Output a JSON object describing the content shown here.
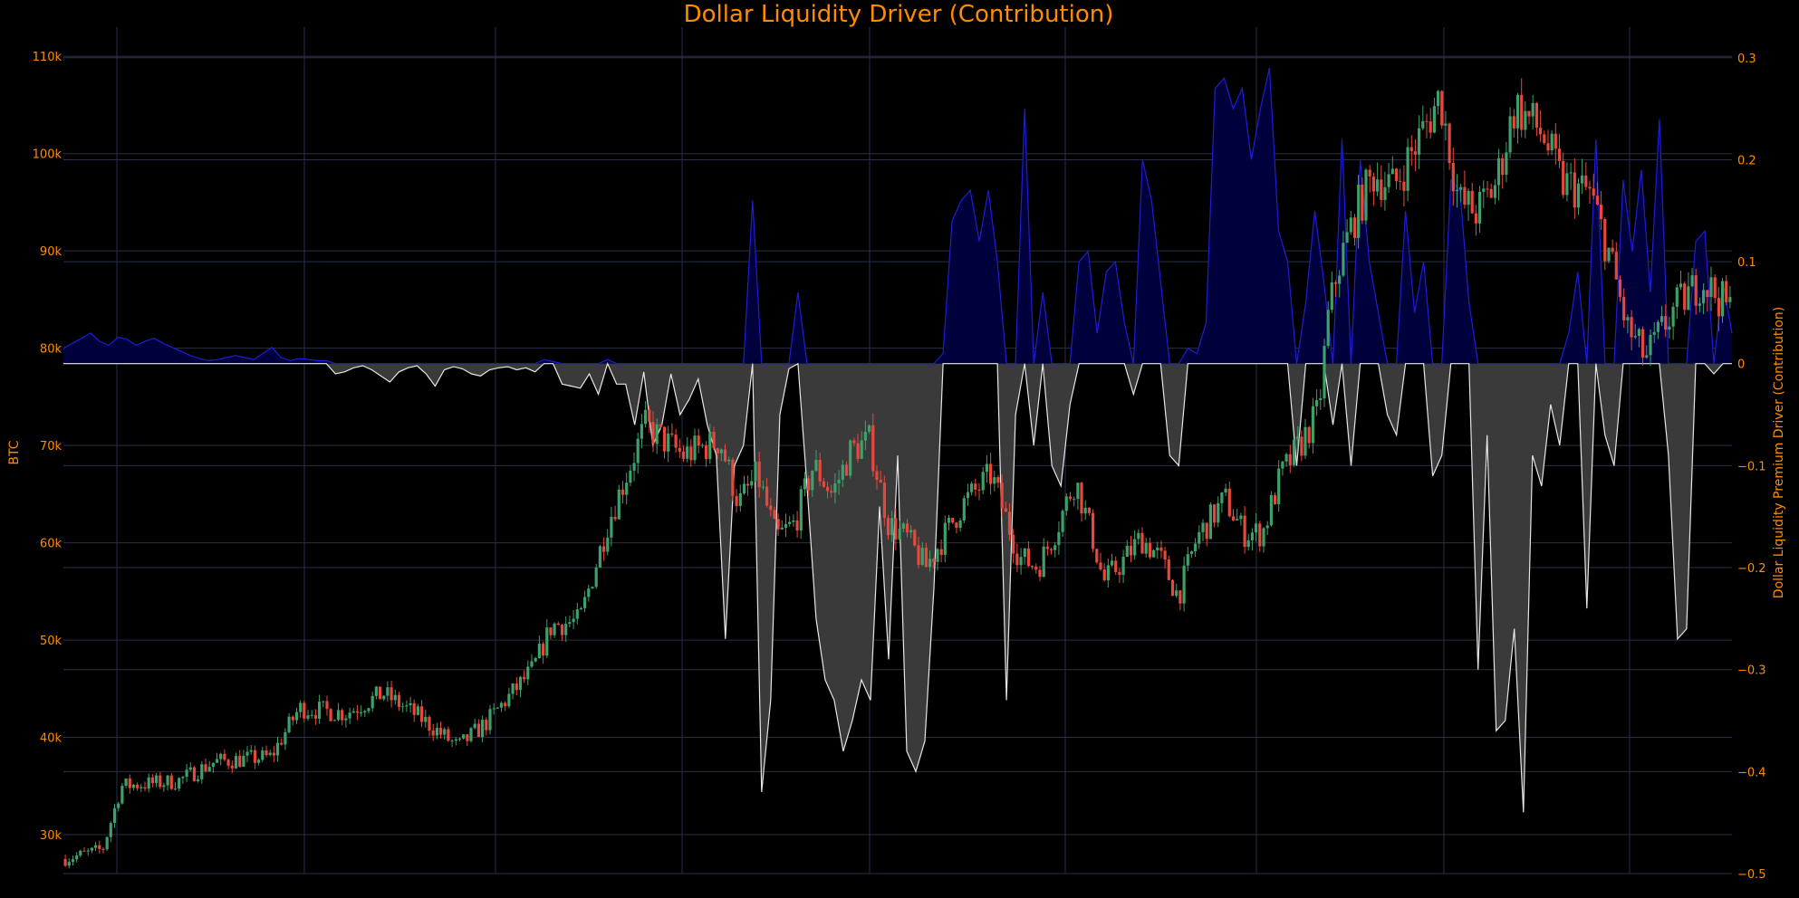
{
  "chart_data": {
    "type": "candlestick+area",
    "title": "Dollar Liquidity Driver (Contribution)",
    "ylabel_left": "BTC",
    "ylabel_right": "Dollar Liquidity Premium Driver (Contribution)",
    "ylim_left": [
      26000,
      113000
    ],
    "ylim_right": [
      -0.5,
      0.33
    ],
    "yticks_left": [
      "30k",
      "40k",
      "50k",
      "60k",
      "70k",
      "80k",
      "90k",
      "100k",
      "110k"
    ],
    "yticks_right": [
      "0.3",
      "0.2",
      "0.1",
      "0",
      "−0.1",
      "−0.2",
      "−0.3",
      "−0.4",
      "−0.5"
    ],
    "grid": true,
    "colors": {
      "background": "#000000",
      "grid": "#2a2f45",
      "text": "#ff8c00",
      "candle_up": "#3ea06a",
      "candle_down": "#e8483c",
      "positive_line": "#1e1ed2",
      "positive_fill": "#00003c",
      "negative_line": "#e6e6e6",
      "negative_fill": "#3a3a3a"
    },
    "btc_path": [
      [
        0,
        27500
      ],
      [
        4,
        28500
      ],
      [
        6,
        35000
      ],
      [
        12,
        35500
      ],
      [
        16,
        37500
      ],
      [
        22,
        38000
      ],
      [
        25,
        43000
      ],
      [
        30,
        42500
      ],
      [
        34,
        44500
      ],
      [
        38,
        42000
      ],
      [
        42,
        39000
      ],
      [
        45,
        41500
      ],
      [
        50,
        47000
      ],
      [
        52,
        51500
      ],
      [
        55,
        52000
      ],
      [
        58,
        62000
      ],
      [
        62,
        72000
      ],
      [
        66,
        69000
      ],
      [
        70,
        70500
      ],
      [
        72,
        64000
      ],
      [
        74,
        67000
      ],
      [
        76,
        60500
      ],
      [
        78,
        62000
      ],
      [
        80,
        68000
      ],
      [
        82,
        65000
      ],
      [
        84,
        69500
      ],
      [
        86,
        70500
      ],
      [
        88,
        62000
      ],
      [
        90,
        60500
      ],
      [
        92,
        57500
      ],
      [
        96,
        64000
      ],
      [
        99,
        67000
      ],
      [
        102,
        58500
      ],
      [
        104,
        57500
      ],
      [
        106,
        61500
      ],
      [
        108,
        66500
      ],
      [
        110,
        60000
      ],
      [
        111,
        56000
      ],
      [
        113,
        58000
      ],
      [
        115,
        60500
      ],
      [
        117,
        58500
      ],
      [
        119,
        54500
      ],
      [
        121,
        60500
      ],
      [
        124,
        64500
      ],
      [
        126,
        61000
      ],
      [
        128,
        61000
      ],
      [
        130,
        67000
      ],
      [
        132,
        70000
      ],
      [
        134,
        73500
      ],
      [
        135,
        83000
      ],
      [
        136,
        88000
      ],
      [
        138,
        94000
      ],
      [
        140,
        98000
      ],
      [
        142,
        96500
      ],
      [
        145,
        102000
      ],
      [
        147,
        106000
      ],
      [
        149,
        95000
      ],
      [
        151,
        94000
      ],
      [
        153,
        97000
      ],
      [
        155,
        105000
      ],
      [
        158,
        102000
      ],
      [
        160,
        97000
      ],
      [
        163,
        96000
      ],
      [
        165,
        90000
      ],
      [
        167,
        82000
      ],
      [
        169,
        79000
      ],
      [
        172,
        84000
      ],
      [
        175,
        87000
      ],
      [
        178,
        84000
      ]
    ],
    "driver_series": [
      0.015,
      0.02,
      0.025,
      0.03,
      0.022,
      0.018,
      0.026,
      0.024,
      0.018,
      0.022,
      0.025,
      0.02,
      0.016,
      0.012,
      0.008,
      0.005,
      0.003,
      0.004,
      0.006,
      0.008,
      0.006,
      0.004,
      0.01,
      0.016,
      0.006,
      0.003,
      0.005,
      0.004,
      0.003,
      0.003,
      -0.01,
      -0.008,
      -0.004,
      -0.002,
      -0.006,
      -0.012,
      -0.018,
      -0.008,
      -0.004,
      -0.002,
      -0.01,
      -0.022,
      -0.006,
      -0.003,
      -0.005,
      -0.01,
      -0.012,
      -0.006,
      -0.004,
      -0.003,
      -0.006,
      -0.004,
      -0.008,
      0.004,
      0.002,
      -0.02,
      -0.022,
      -0.024,
      -0.01,
      -0.03,
      0.004,
      -0.02,
      -0.02,
      -0.06,
      -0.008,
      -0.08,
      -0.06,
      -0.01,
      -0.05,
      -0.035,
      -0.015,
      -0.06,
      -0.09,
      -0.27,
      -0.1,
      -0.08,
      0.16,
      -0.42,
      -0.33,
      -0.05,
      -0.005,
      0.07,
      -0.12,
      -0.25,
      -0.31,
      -0.33,
      -0.38,
      -0.35,
      -0.31,
      -0.33,
      -0.14,
      -0.29,
      -0.09,
      -0.38,
      -0.4,
      -0.37,
      -0.22,
      0.01,
      0.14,
      0.16,
      0.17,
      0.12,
      0.17,
      0.1,
      -0.33,
      -0.05,
      0.25,
      -0.08,
      0.07,
      -0.1,
      -0.12,
      -0.04,
      0.1,
      0.11,
      0.03,
      0.09,
      0.1,
      0.04,
      -0.03,
      0.2,
      0.16,
      0.08,
      -0.09,
      -0.1,
      0.015,
      0.01,
      0.04,
      0.27,
      0.28,
      0.25,
      0.27,
      0.2,
      0.25,
      0.29,
      0.13,
      0.1,
      -0.1,
      0.06,
      0.15,
      0.08,
      -0.06,
      0.22,
      -0.1,
      0.2,
      0.1,
      0.05,
      -0.05,
      -0.07,
      0.15,
      0.05,
      0.1,
      -0.11,
      -0.09,
      0.18,
      0.17,
      0.06,
      -0.3,
      -0.07,
      -0.36,
      -0.35,
      -0.26,
      -0.44,
      -0.09,
      -0.12,
      -0.04,
      -0.08,
      0.03,
      0.09,
      -0.24,
      0.22,
      -0.07,
      -0.1,
      0.18,
      0.11,
      0.19,
      0.07,
      0.24,
      -0.09,
      -0.27,
      -0.26,
      0.12,
      0.13,
      -0.01,
      0.08,
      0.03
    ]
  }
}
